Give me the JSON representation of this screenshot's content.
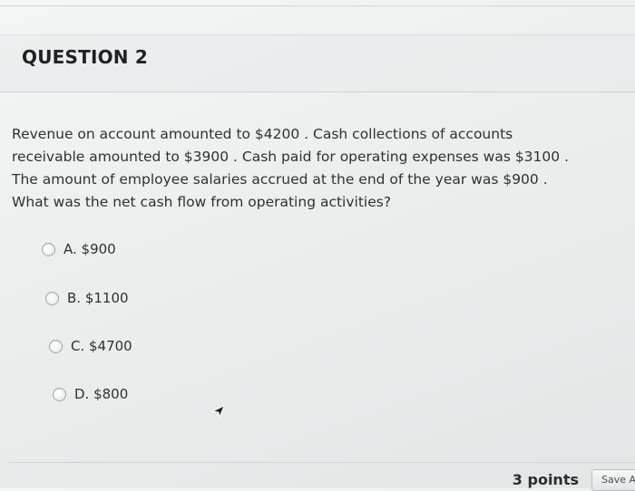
{
  "question": {
    "title": "QUESTION 2",
    "text_lines": [
      "Revenue on account amounted to $4200 . Cash collections of accounts",
      "receivable amounted to $3900 . Cash paid for operating expenses was $3100 .",
      "The amount of employee salaries accrued at the end of the year was $900 .",
      "What was the net cash flow from operating activities?"
    ],
    "answers": [
      {
        "label": "A. $900",
        "selected": false
      },
      {
        "label": "B. $1100",
        "selected": false
      },
      {
        "label": "C. $4700",
        "selected": false
      },
      {
        "label": "D. $800",
        "selected": false
      }
    ]
  },
  "footer": {
    "points": "3 points",
    "save_label": "Save A"
  },
  "icons": {
    "cursor": "mouse-pointer-icon"
  }
}
